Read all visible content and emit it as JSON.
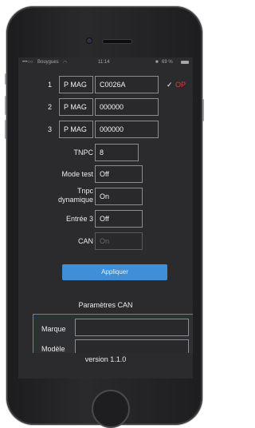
{
  "status_bar": {
    "carrier": "Bouygues",
    "time": "11:14",
    "battery": "69 %"
  },
  "rows": [
    {
      "num": "1",
      "type": "P MAG",
      "value": "C0026A",
      "check": "✓",
      "status": "OP"
    },
    {
      "num": "2",
      "type": "P MAG",
      "value": "000000"
    },
    {
      "num": "3",
      "type": "P MAG",
      "value": "000000"
    }
  ],
  "settings": {
    "tnpc_label": "TNPC",
    "tnpc_value": "8",
    "mode_test_label": "Mode test",
    "mode_test_value": "Off",
    "tnpc_dyn_label_1": "Tnpc",
    "tnpc_dyn_label_2": "dynamique",
    "tnpc_dyn_value": "On",
    "entree3_label": "Entrée 3",
    "entree3_value": "Off",
    "can_label": "CAN",
    "can_value": "On"
  },
  "apply_button": "Appliquer",
  "can_section": {
    "title": "Paramètres CAN",
    "marque_label": "Marque",
    "modele_label": "Modèle"
  },
  "version": "version 1.1.0",
  "colors": {
    "accent": "#3f8fd8",
    "ok_status": "#e23a2c",
    "background": "#2b2b2d"
  }
}
